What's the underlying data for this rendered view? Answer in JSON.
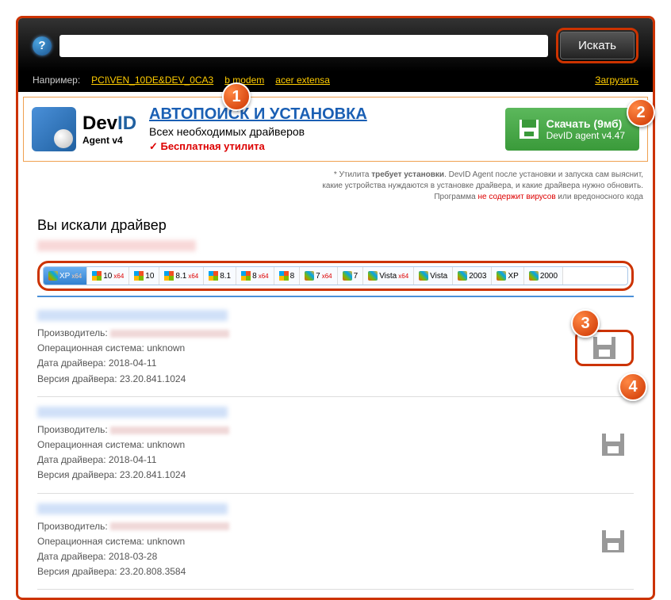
{
  "header": {
    "search_value": "",
    "search_button": "Искать",
    "example_label": "Например:",
    "examples": [
      "PCI\\VEN_10DE&DEV_0CA3",
      "b modem",
      "acer extensa"
    ],
    "upload_link": "Загрузить"
  },
  "promo": {
    "logo_main": "Dev",
    "logo_accent": "ID",
    "logo_sub": "Agent v4",
    "title": "АВТОПОИСК И УСТАНОВКА",
    "subtitle": "Всех необходимых драйверов",
    "free_label": "Бесплатная утилита",
    "download_label": "Скачать (9мб)",
    "download_sub": "DevID agent v4.47"
  },
  "disclaimer": {
    "line1_prefix": "* Утилита ",
    "line1_bold": "требует установки",
    "line1_suffix": ". DevID Agent после установки и запуска сам выяснит,",
    "line2": "какие устройства нуждаются в установке драйвера, и какие драйвера нужно обновить.",
    "line3_prefix": "Программа ",
    "line3_bold": "не содержит вирусов",
    "line3_suffix": " или вредоносного кода"
  },
  "results": {
    "heading": "Вы искали драйвер",
    "os_tabs": [
      {
        "label": "XP",
        "x64": true,
        "active": true,
        "icon": "old"
      },
      {
        "label": "10",
        "x64": true,
        "icon": "new"
      },
      {
        "label": "10",
        "x64": false,
        "icon": "new"
      },
      {
        "label": "8.1",
        "x64": true,
        "icon": "new"
      },
      {
        "label": "8.1",
        "x64": false,
        "icon": "new"
      },
      {
        "label": "8",
        "x64": true,
        "icon": "new"
      },
      {
        "label": "8",
        "x64": false,
        "icon": "new"
      },
      {
        "label": "7",
        "x64": true,
        "icon": "old"
      },
      {
        "label": "7",
        "x64": false,
        "icon": "old"
      },
      {
        "label": "Vista",
        "x64": true,
        "icon": "old"
      },
      {
        "label": "Vista",
        "x64": false,
        "icon": "old"
      },
      {
        "label": "2003",
        "x64": false,
        "icon": "old"
      },
      {
        "label": "XP",
        "x64": false,
        "icon": "old"
      },
      {
        "label": "2000",
        "x64": false,
        "icon": "old"
      }
    ],
    "labels": {
      "manufacturer": "Производитель:",
      "os": "Операционная система:",
      "date": "Дата драйвера:",
      "version": "Версия драйвера:"
    },
    "items": [
      {
        "os": "unknown",
        "date": "2018-04-11",
        "version": "23.20.841.1024",
        "highlighted": true
      },
      {
        "os": "unknown",
        "date": "2018-04-11",
        "version": "23.20.841.1024",
        "highlighted": false
      },
      {
        "os": "unknown",
        "date": "2018-03-28",
        "version": "23.20.808.3584",
        "highlighted": false
      }
    ]
  },
  "callouts": [
    "1",
    "2",
    "3",
    "4"
  ]
}
